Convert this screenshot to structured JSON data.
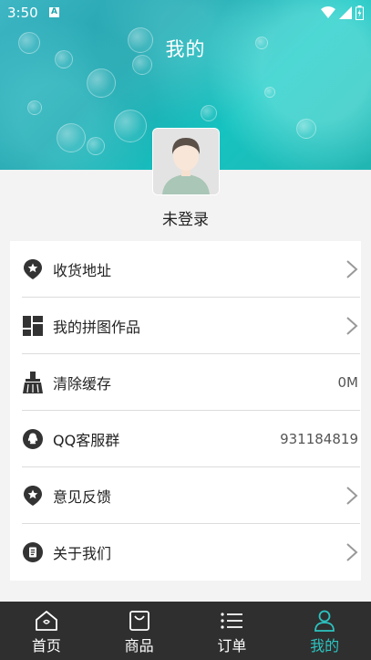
{
  "status_bar": {
    "time": "3:50",
    "notification_letter": "A"
  },
  "header": {
    "title": "我的"
  },
  "profile": {
    "username": "未登录"
  },
  "menu": [
    {
      "label": "收货地址",
      "value": "",
      "icon": "location-star-icon",
      "trailing": "chevron"
    },
    {
      "label": "我的拼图作品",
      "value": "",
      "icon": "puzzle-grid-icon",
      "trailing": "chevron"
    },
    {
      "label": "清除缓存",
      "value": "0M",
      "icon": "broom-icon",
      "trailing": "value"
    },
    {
      "label": "QQ客服群",
      "value": "931184819",
      "icon": "qq-icon",
      "trailing": "value"
    },
    {
      "label": "意见反馈",
      "value": "",
      "icon": "feedback-pin-icon",
      "trailing": "chevron"
    },
    {
      "label": "关于我们",
      "value": "",
      "icon": "about-doc-icon",
      "trailing": "chevron"
    }
  ],
  "tabs": [
    {
      "label": "首页",
      "icon": "home-icon",
      "active": false
    },
    {
      "label": "商品",
      "icon": "bag-icon",
      "active": false
    },
    {
      "label": "订单",
      "icon": "list-icon",
      "active": false
    },
    {
      "label": "我的",
      "icon": "user-icon",
      "active": true
    }
  ],
  "colors": {
    "accent": "#2cc4c1",
    "tabbar_bg": "#2f2f2f",
    "icon_dark": "#333333"
  }
}
